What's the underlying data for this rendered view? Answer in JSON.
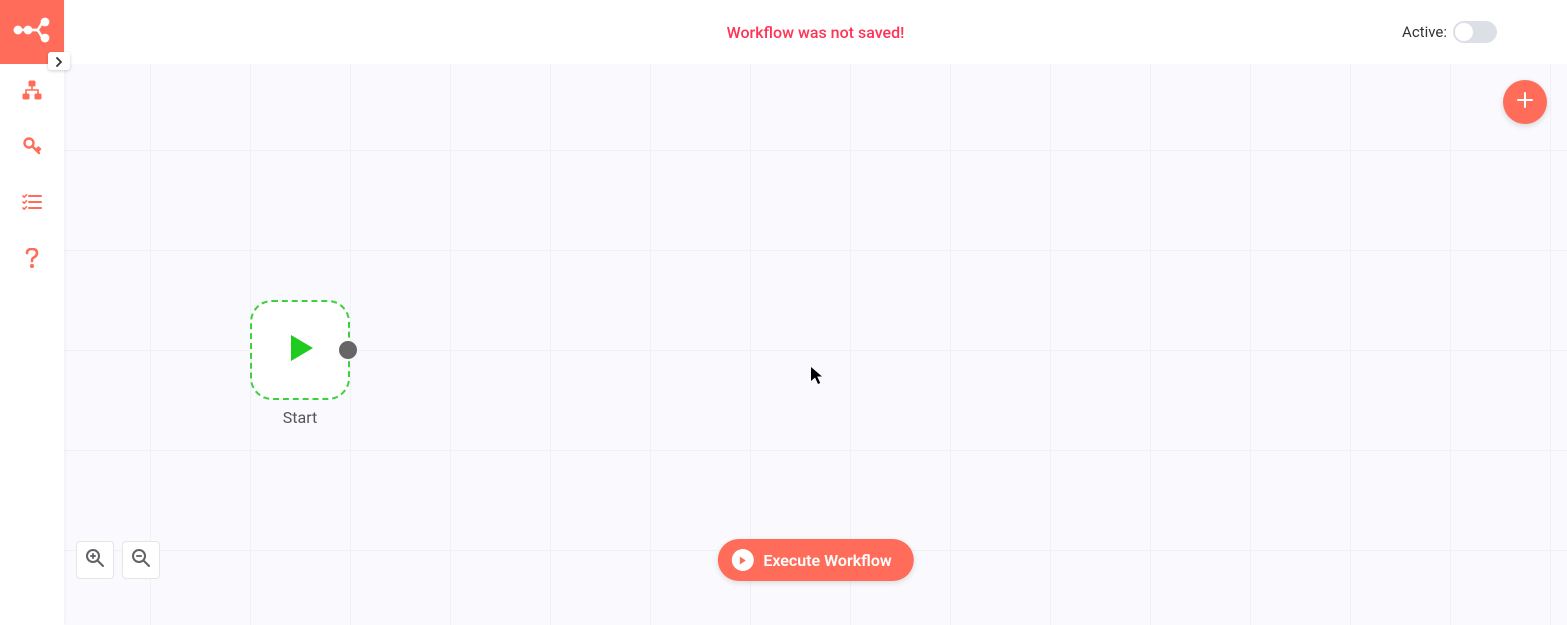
{
  "header": {
    "message": "Workflow was not saved!",
    "active_label": "Active:",
    "active_state": false
  },
  "sidebar": {
    "items": [
      {
        "name": "logo",
        "icon": "logo-icon"
      },
      {
        "name": "workflows",
        "icon": "workflows-icon"
      },
      {
        "name": "credentials",
        "icon": "key-icon"
      },
      {
        "name": "executions",
        "icon": "list-icon"
      },
      {
        "name": "help",
        "icon": "question-icon"
      }
    ],
    "expand_icon": "chevron-right-icon"
  },
  "canvas": {
    "node": {
      "type": "start",
      "label": "Start",
      "icon": "play-icon"
    },
    "add_button_icon": "plus-icon",
    "zoom": {
      "in_icon": "zoom-in-icon",
      "out_icon": "zoom-out-icon"
    },
    "execute_button": {
      "label": "Execute Workflow",
      "icon": "play-circle-icon"
    }
  },
  "colors": {
    "accent": "#ff6d5a",
    "error_text": "#ff3355",
    "node_border": "#3dd23d",
    "play_icon": "#1ecb1e"
  }
}
